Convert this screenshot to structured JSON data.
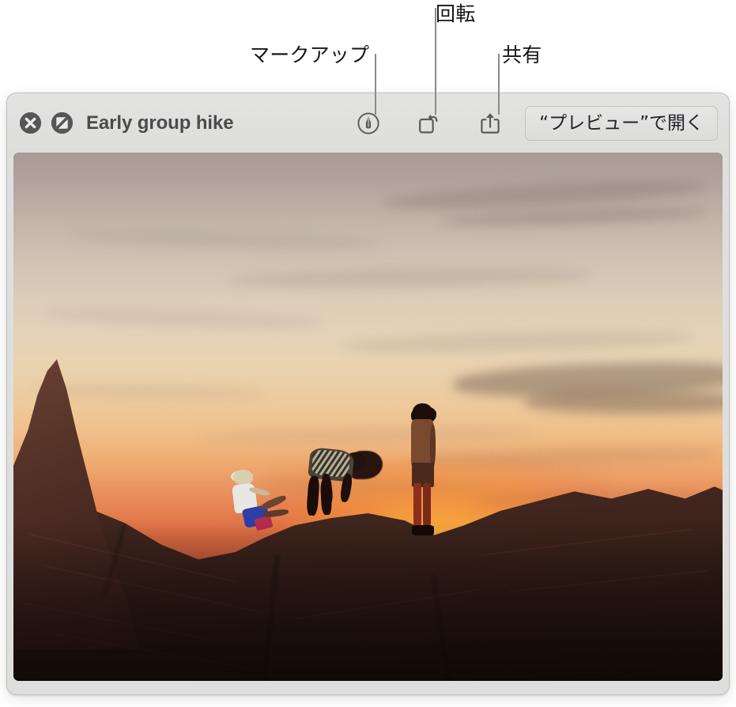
{
  "annotations": [
    {
      "id": "markup",
      "label": "マークアップ",
      "icon": "markup-icon"
    },
    {
      "id": "rotate",
      "label": "回転",
      "icon": "rotate-icon"
    },
    {
      "id": "share",
      "label": "共有",
      "icon": "share-icon"
    }
  ],
  "window": {
    "title": "Early group hike",
    "close_icon": "close-icon",
    "quicklook_icon": "circle-slash-icon",
    "toolbar": {
      "markup_icon": "markup-icon",
      "markup_tooltip": "マークアップ",
      "rotate_icon": "rotate-icon",
      "rotate_tooltip": "回転",
      "share_icon": "share-icon",
      "share_tooltip": "共有",
      "open_button_label": "“プレビュー”で開く"
    }
  },
  "photo": {
    "alt": "Early group hike",
    "description": "砂岩の岩場に立つ3人のハイカーと夕焼けの空",
    "colors": {
      "sky_top": "#a89a95",
      "sky_mid": "#e8d3b3",
      "sun_glow": "#ffd660",
      "horizon": "#e37d4e",
      "rock": "#3b231b",
      "rock_highlight": "#6d4334"
    }
  },
  "chrome": {
    "window_bg": "#dededd",
    "toolbar_bg": "#e0e0df",
    "title_color": "#4b4b4b",
    "button_fill": "#565656",
    "callout_line": "#8b8b8b",
    "callout_text": "#16161a"
  }
}
